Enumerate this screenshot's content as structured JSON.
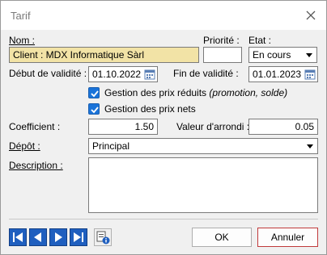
{
  "window": {
    "title": "Tarif"
  },
  "labels": {
    "nom": "Nom :",
    "priorite": "Priorité :",
    "etat": "Etat :",
    "debut": "Début de validité :",
    "fin": "Fin de validité :",
    "coefficient": "Coefficient :",
    "arrondi": "Valeur d'arrondi :",
    "depot": "Dépôt :",
    "description": "Description :"
  },
  "fields": {
    "nom": "Client : MDX Informatique Sàrl",
    "priorite": "",
    "etat": "En cours",
    "debut": "01.10.2022",
    "fin": "01.01.2023",
    "coefficient": "1.50",
    "arrondi": "0.05",
    "depot": "Principal",
    "description": ""
  },
  "checkboxes": {
    "prix_reduits": {
      "label": "Gestion des prix réduits",
      "suffix": "(promotion, solde)",
      "checked": true
    },
    "prix_nets": {
      "label": "Gestion des prix nets",
      "checked": true
    }
  },
  "buttons": {
    "ok": "OK",
    "cancel": "Annuler"
  },
  "icons": {
    "close": "close-icon",
    "calendar": "calendar-icon",
    "first": "first-record-icon",
    "prev": "previous-record-icon",
    "next": "next-record-icon",
    "last": "last-record-icon",
    "info": "record-info-icon"
  },
  "colors": {
    "accent": "#1a73d9",
    "nav": "#1f5fbf",
    "nom_field": "#f2e3a6",
    "cancel_border": "#c0393b"
  }
}
